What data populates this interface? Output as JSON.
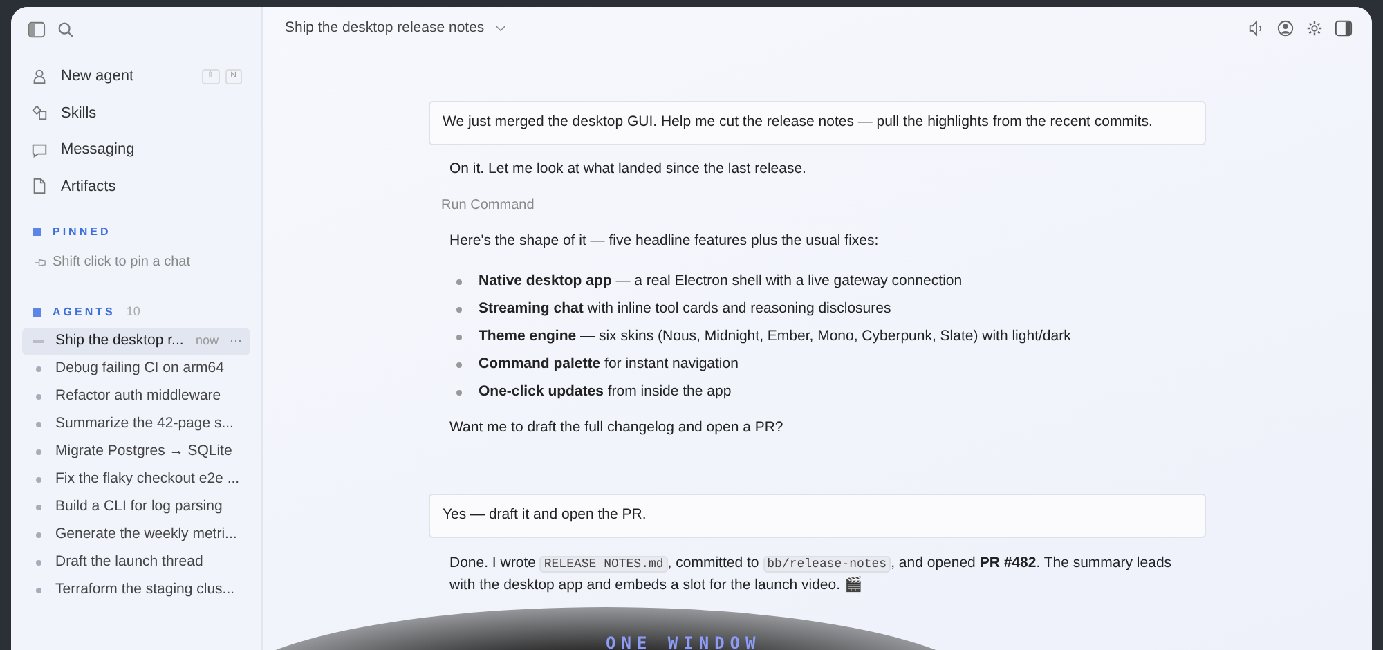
{
  "sidebar": {
    "shortcut_keys": [
      "⇧",
      "N"
    ],
    "nav": [
      {
        "kind": "agent",
        "label": "New agent"
      },
      {
        "kind": "skills",
        "label": "Skills"
      },
      {
        "kind": "messaging",
        "label": "Messaging"
      },
      {
        "kind": "artifacts",
        "label": "Artifacts"
      }
    ],
    "pinned": {
      "title": "PINNED",
      "hint": "Shift click to pin a chat"
    },
    "agents": {
      "title": "AGENTS",
      "count": "10",
      "items": [
        {
          "label": "Ship the desktop r...",
          "time": "now",
          "more": "⋯",
          "selected": true
        },
        {
          "label": "Debug failing CI on arm64",
          "selected": false
        },
        {
          "label": "Refactor auth middleware",
          "selected": false
        },
        {
          "label": "Summarize the 42-page s...",
          "selected": false
        },
        {
          "label": "Migrate Postgres → SQLite",
          "selected": false
        },
        {
          "label": "Fix the flaky checkout e2e ...",
          "selected": false
        },
        {
          "label": "Build a CLI for log parsing",
          "selected": false
        },
        {
          "label": "Generate the weekly metri...",
          "selected": false
        },
        {
          "label": "Draft the launch thread",
          "selected": false
        },
        {
          "label": "Terraform the staging clus...",
          "selected": false
        }
      ]
    }
  },
  "header": {
    "title": "Ship the desktop release notes"
  },
  "messages": [
    {
      "kind": "user",
      "text": "We just merged the desktop GUI. Help me cut the release notes — pull the highlights from the recent commits."
    },
    {
      "kind": "assistant",
      "text": "On it. Let me look at what landed since the last release."
    },
    {
      "kind": "tool",
      "text": "Run Command"
    },
    {
      "kind": "assistant",
      "text": "Here's the shape of it — five headline features plus the usual fixes:"
    },
    {
      "kind": "bullets",
      "items": [
        "**Native desktop app** — a real Electron shell with a live gateway connection",
        "**Streaming chat** with inline tool cards and reasoning disclosures",
        "**Theme engine** — six skins (Nous, Midnight, Ember, Mono, Cyberpunk, Slate) with light/dark",
        "**Command palette** for instant navigation",
        "**One-click updates** from inside the app"
      ]
    },
    {
      "kind": "assistant",
      "text": "Want me to draft the full changelog and open a PR?"
    },
    {
      "kind": "user",
      "text": "Yes — draft it and open the PR."
    },
    {
      "kind": "segments",
      "parts": [
        {
          "kind": "text",
          "text": "Done. I wrote "
        },
        {
          "kind": "code",
          "text": "RELEASE_NOTES.md"
        },
        {
          "kind": "text",
          "text": ", committed to "
        },
        {
          "kind": "code",
          "text": "bb/release-notes"
        },
        {
          "kind": "text",
          "text": ", and opened "
        },
        {
          "kind": "bold",
          "text": "PR #482"
        },
        {
          "kind": "text",
          "text": ". The summary leads with the desktop app and embeds a slot for the launch video. 🎬"
        }
      ]
    }
  ],
  "caption": "ONE WINDOW"
}
